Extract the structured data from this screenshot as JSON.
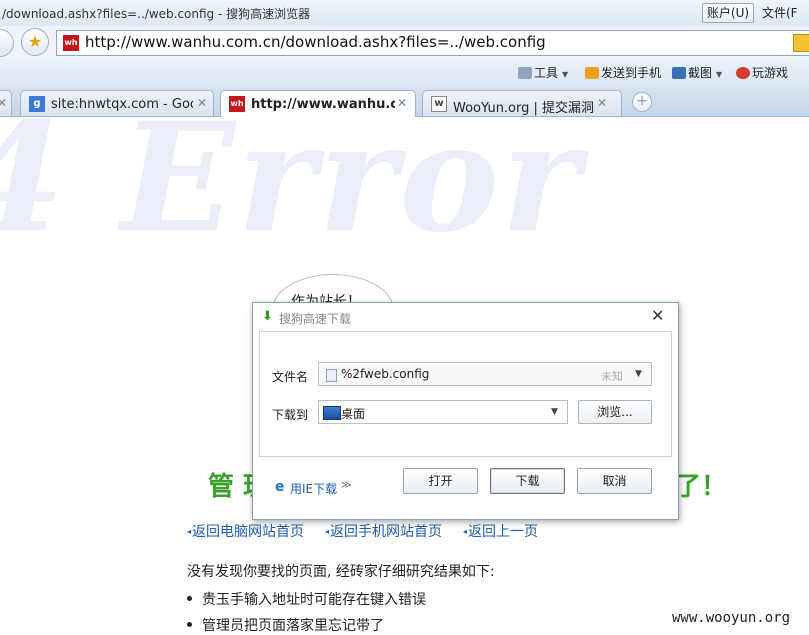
{
  "window": {
    "title": "/download.ashx?files=../web.config - 搜狗高速浏览器",
    "menu": [
      "账户(U)",
      "文件(F"
    ]
  },
  "address_bar": {
    "url": "http://www.wanhu.com.cn/download.ashx?files=../web.config",
    "favicon_text": "wh"
  },
  "toolbar": {
    "items": [
      "工具",
      "发送到手机",
      "截图",
      "玩游戏"
    ]
  },
  "tabs": [
    {
      "label": "site:hnwtqx.com - Goo...",
      "favicon": "g-icon",
      "active": false
    },
    {
      "label": "http://www.wanhu.co...",
      "favicon": "wanhu-icon",
      "active": true
    },
    {
      "label": "WooYun.org | 提交漏洞",
      "favicon": "wooyun-icon",
      "active": false
    }
  ],
  "page": {
    "bg_text": "4 Error",
    "bubble_text": "作为站长！",
    "headline_left": "管 理",
    "headline_right": "了！",
    "links": [
      "返回电脑网站首页",
      "返回手机网站首页",
      "返回上一页"
    ],
    "notfound": "没有发现你要找的页面, 经砖家仔细研究结果如下:",
    "reasons": [
      "贵玉手输入地址时可能存在键入错误",
      "管理员把页面落家里忘记带了"
    ],
    "watermark": "www.wooyun.org"
  },
  "dialog": {
    "title": "搜狗高速下载",
    "filename_label": "文件名",
    "filename_value": "%2fweb.config",
    "filename_size": "未知",
    "saveto_label": "下载到",
    "saveto_value": "桌面",
    "browse_label": "浏览...",
    "use_ie_label": "用IE下载",
    "open_label": "打开",
    "download_label": "下载",
    "cancel_label": "取消"
  }
}
